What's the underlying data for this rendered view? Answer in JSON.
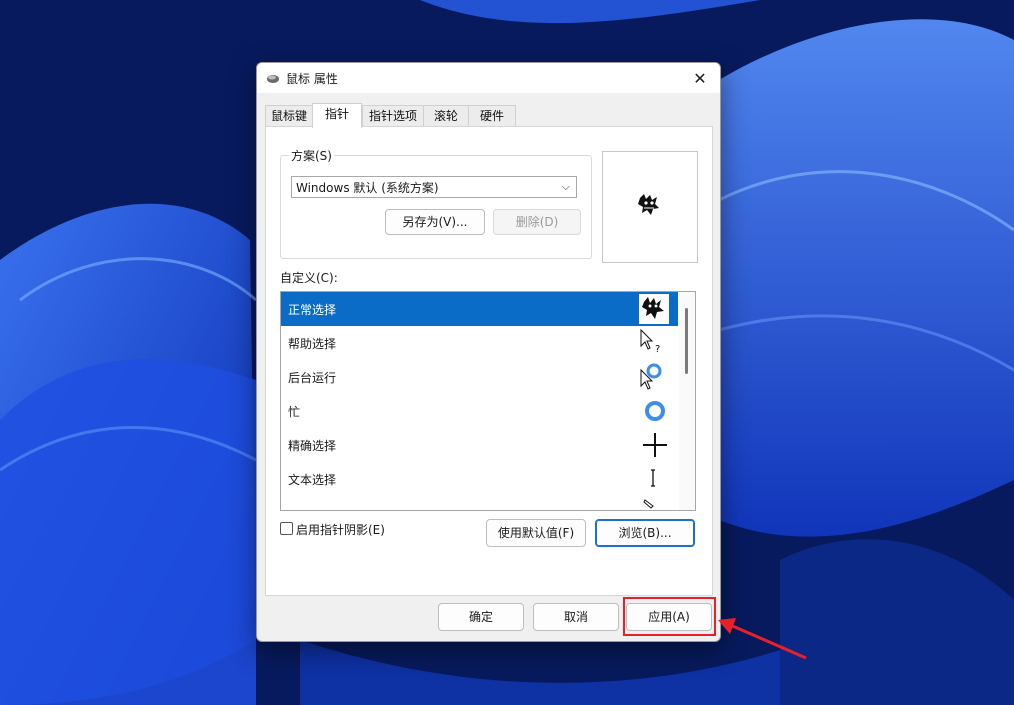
{
  "dialog": {
    "title": "鼠标 属性",
    "close_glyph": "✕"
  },
  "tabs": [
    {
      "label": "鼠标键",
      "active": false
    },
    {
      "label": "指针",
      "active": true
    },
    {
      "label": "指针选项",
      "active": false
    },
    {
      "label": "滚轮",
      "active": false
    },
    {
      "label": "硬件",
      "active": false
    }
  ],
  "scheme": {
    "legend": "方案(S)",
    "selected": "Windows 默认 (系统方案)",
    "save_as_label": "另存为(V)...",
    "delete_label": "删除(D)"
  },
  "custom": {
    "label": "自定义(C):",
    "items": [
      {
        "label": "正常选择",
        "icon": "gremlin-cursor-icon",
        "selected": true
      },
      {
        "label": "帮助选择",
        "icon": "help-cursor-icon",
        "selected": false
      },
      {
        "label": "后台运行",
        "icon": "working-cursor-icon",
        "selected": false
      },
      {
        "label": "忙",
        "icon": "busy-cursor-icon",
        "selected": false
      },
      {
        "label": "精确选择",
        "icon": "precision-cursor-icon",
        "selected": false
      },
      {
        "label": "文本选择",
        "icon": "text-cursor-icon",
        "selected": false
      },
      {
        "label": "",
        "icon": "handwriting-cursor-icon",
        "selected": false
      }
    ]
  },
  "shadow_checkbox": {
    "label": "启用指针阴影(E)",
    "checked": false
  },
  "use_default_label": "使用默认值(F)",
  "browse_label": "浏览(B)...",
  "footer": {
    "ok_label": "确定",
    "cancel_label": "取消",
    "apply_label": "应用(A)"
  },
  "colors": {
    "selection": "#0b6cc8",
    "annotation": "#e8202a",
    "busy_ring": "#3d8ee8"
  }
}
